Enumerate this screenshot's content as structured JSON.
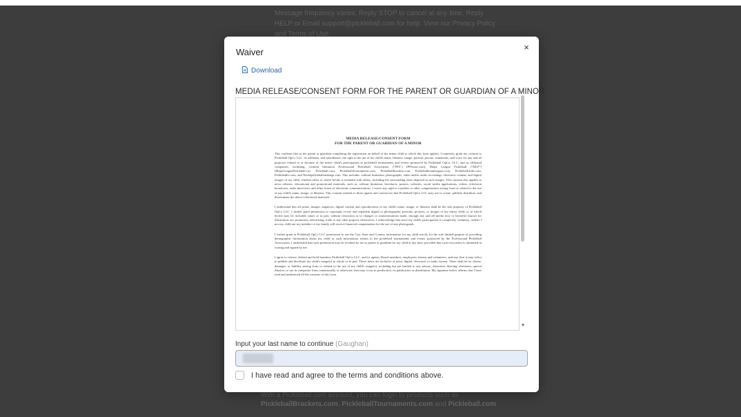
{
  "background": {
    "text_lines": [
      "Message frequency varies. Reply STOP to cancel at any time. Reply",
      "HELP or Email support@pickleball.com for help. View our Privacy Policy",
      "and Terms of Use."
    ],
    "footer_text": "With a Pickleball.com account, you can login to products such as",
    "footer_links": [
      "PickleballBrackets.com",
      "PickleballTournaments.com",
      "Pickleball.com"
    ],
    "footer_sep1": ", ",
    "footer_sep2": " and "
  },
  "modal": {
    "title": "Waiver",
    "close_symbol": "×",
    "download_label": "Download",
    "document_title": "MEDIA RELEASE/CONSENT FORM FOR THE PARENT OR GUARDIAN OF A MINOR",
    "document": {
      "heading_line1": "MEDIA RELEASE/CONSENT FORM",
      "heading_line2": "FOR THE PARENT OR GUARDIAN OF A MINOR",
      "para1": "This confirms that as the parent or guardian completing the registration on behalf of the minor child to which this form applies, I expressly, grant my consent to Pickleball OpCo LLC, its affiliates, and subsidiaries, the right to the use of my child's name, likeness, image, portrait, picture, statements, and voice for any and all purposes related to or because of the minor child's participation in pickleball tournaments and events sponsored by Pickleball OpCo, LLC, and its affiliated companies, including, without limitation Professional Pickleball Association (\"PPA\") (PPAtour.com), Major League Pickleball (\"MLP\") (MajorLeaguePickleball.co), Pickleball.com, PickleballTournaments.com, Pickleballbrackets.com, Pickleballteamleagues.com, Pickleballclubs.com, Pickleballtv.com, and Worldpickleballrankings.com. This includes, without limitation, photographs, video and/or audio recordings, electronic content, and digital images of my child, whether alone or where he/she is included with others, including the surrounding areas depicted in such images. This consent also applies to news releases, educational and promotional materials, such as, without limitation, brochures, posters, websites, social media applications, videos, television broadcasts, radio interviews and other forms of electronic communications. I waive any right to royalties or other compensation arising from or related to the use of my child's name, image, or likeness. This consent extends to those agents and contractors that Pickleball OpCo LLC may use to create, publish, distribute, and disseminate the above-referenced materials.",
      "para2": "I understand that all prints, images, negatives, digital content and reproductions of my child's name, image, or likeness shall be the sole property of Pickleball OpCo LLC. I further grant permission to copyright, re-use and republish digital or photographic portraits, pictures, or images of my minor child, or in which he/she may be included, intact or in part, without restriction as to changes or transformations made, through any and all media now or hereafter known for illustration, art, promotion, advertising, trade or any other purpose whatsoever. I acknowledge that since my child's participation is completely voluntary, neither I nor my child nor my member of my family will receive financial compensation for the use of any photograph.",
      "para3": "I further grant to Pickleball OpCo LLC permission to use the City, State and Country information for my child strictly for the sole limited purpose of providing demographic information about my child as such information relates to the pickleball tournaments and events sponsored by the Professional Pickleball Association. I understand that such permission may be revoked by me as parent or guardian for my child at any time, provided that such revocation is submitted in writing and signed by me.",
      "para4": "I agree to release, defend and hold harmless Pickleball OpCo LLC. and its agents, Board members, employees, interns and volunteers, and any firm it may select to publish and distribute my child's image(s) in whole or in part. These items are inclusive of print, digital, electronic or audio format. There shall be no claims, damages, or liability arising from or related to the use of my child's image(s), including but not limited to any misuse, distortion, blurring, alteration, optical illusion, or use in composite form, intentionally or otherwise, that may occur in production, its publication or distribution. My signature below affirms that I have read and understood all the contents of this form."
    },
    "input_label": "Input your last name to continue",
    "input_hint": "(Gaughan)",
    "input_value": "",
    "agree_label": "I have read and agree to the terms and conditions above.",
    "agree_checked": false
  }
}
